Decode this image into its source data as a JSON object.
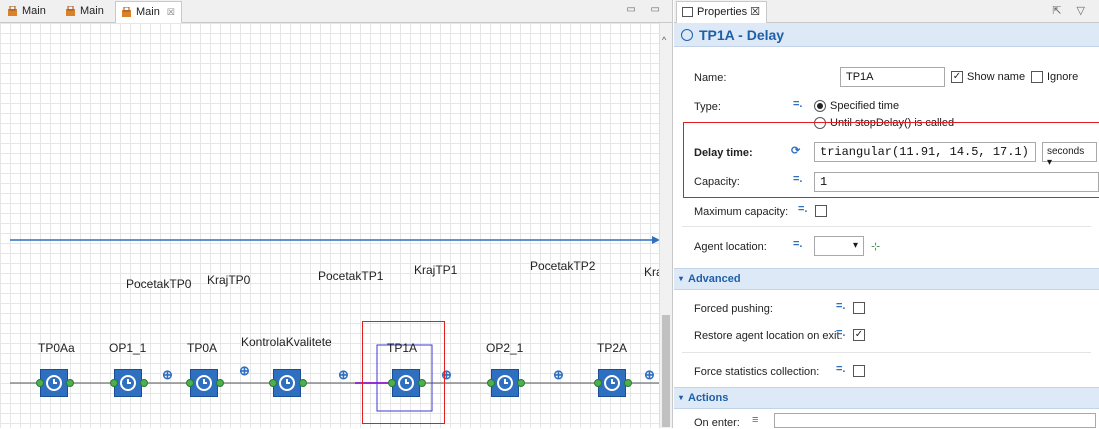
{
  "editor": {
    "tabs": [
      {
        "label": "Main"
      },
      {
        "label": "Main"
      },
      {
        "label": "Main",
        "close": "☒"
      }
    ],
    "window_controls": "▭ ▭",
    "top_labels": [
      "PocetakTP0",
      "KrajTP0",
      "PocetakTP1",
      "KrajTP1",
      "PocetakTP2",
      "Kra"
    ],
    "blocks": [
      {
        "label": "TP0Aa"
      },
      {
        "label": "OP1_1"
      },
      {
        "label": "TP0A"
      },
      {
        "label": "KontrolaKvalitete"
      },
      {
        "label": "TP1A"
      },
      {
        "label": "OP2_1"
      },
      {
        "label": "TP2A"
      }
    ]
  },
  "properties": {
    "tab_label": "Properties ☒",
    "title": "TP1A - Delay",
    "name_label": "Name:",
    "name_value": "TP1A",
    "show_name_label": "Show name",
    "show_name_checked": "✓",
    "ignore_label": "Ignore",
    "type_label": "Type:",
    "type_option1": "Specified time",
    "type_option2": "Until stopDelay() is called",
    "delay_label": "Delay time:",
    "delay_value": "triangular(11.91, 14.5, 17.1)",
    "delay_unit": "seconds ▾",
    "capacity_label": "Capacity:",
    "capacity_value": "1",
    "max_capacity_label": "Maximum capacity:",
    "agent_location_label": "Agent location:",
    "advanced_section": "Advanced",
    "forced_pushing_label": "Forced pushing:",
    "restore_label": "Restore agent location on exit:",
    "restore_checked": "✓",
    "force_stats_label": "Force statistics collection:",
    "actions_section": "Actions",
    "on_enter_label": "On enter:"
  },
  "colors": {
    "accent": "#2e6fbf",
    "highlight": "#e02020",
    "connector": "#4caf50",
    "section_bg": "#dde9f7"
  }
}
